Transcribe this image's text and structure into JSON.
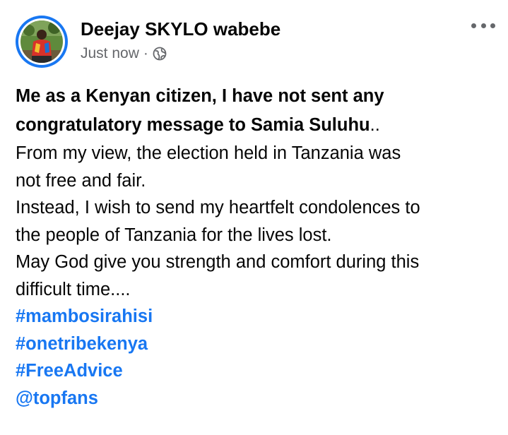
{
  "post": {
    "author": "Deejay SKYLO wabebe",
    "timestamp": "Just now",
    "separator": "·",
    "privacy_icon": "globe-icon",
    "more_icon": "more-horizontal-icon",
    "avatar_icon": "profile-photo",
    "body": {
      "bold_line_1": "Me as a Kenyan citizen, I have not sent any",
      "bold_line_2": "congratulatory message to Samia Suluhu",
      "bold_line_2_tail": "..",
      "lines": [
        "From my view, the election held in Tanzania was",
        "not free and fair.",
        "Instead, I wish to send my heartfelt condolences to",
        "the people of Tanzania for the lives lost.",
        "May God give you strength and comfort during this",
        "difficult time...."
      ],
      "tags": [
        "#mambosirahisi",
        "#onetribekenya",
        "#FreeAdvice",
        "@topfans"
      ]
    }
  },
  "colors": {
    "accent": "#1877f2",
    "secondary_text": "#65676b",
    "primary_text": "#050505"
  }
}
